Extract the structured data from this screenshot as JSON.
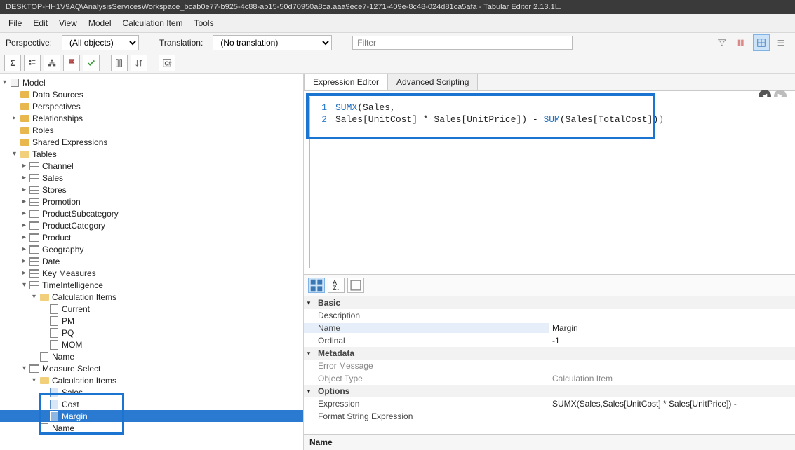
{
  "window": {
    "title": "DESKTOP-HH1V9AQ\\AnalysisServicesWorkspace_bcab0e77-b925-4c88-ab15-50d70950a8ca.aaa9ece7-1271-409e-8c48-024d81ca5afa - Tabular Editor 2.13.1",
    "btn_min": "—",
    "btn_max": "☐",
    "btn_close": "✕"
  },
  "menu": {
    "file": "File",
    "edit": "Edit",
    "view": "View",
    "model": "Model",
    "calcitem": "Calculation Item",
    "tools": "Tools"
  },
  "filters": {
    "perspective_lbl": "Perspective:",
    "perspective_val": "(All objects)",
    "translation_lbl": "Translation:",
    "translation_val": "(No translation)",
    "filter_ph": "Filter"
  },
  "tree": {
    "root": "Model",
    "datasources": "Data Sources",
    "perspectives": "Perspectives",
    "relationships": "Relationships",
    "roles": "Roles",
    "shared": "Shared Expressions",
    "tables": "Tables",
    "tbl": {
      "channel": "Channel",
      "sales": "Sales",
      "stores": "Stores",
      "promotion": "Promotion",
      "prodsub": "ProductSubcategory",
      "prodcat": "ProductCategory",
      "product": "Product",
      "geo": "Geography",
      "date": "Date",
      "keym": "Key Measures",
      "timeint": "TimeIntelligence",
      "meassel": "Measure Select"
    },
    "calcitems": "Calculation Items",
    "ti": {
      "current": "Current",
      "pm": "PM",
      "pq": "PQ",
      "mom": "MOM"
    },
    "name": "Name",
    "ms": {
      "sales": "Sales",
      "cost": "Cost",
      "margin": "Margin"
    }
  },
  "tabs": {
    "expr": "Expression Editor",
    "adv": "Advanced Scripting"
  },
  "code": {
    "l1a": "SUMX",
    "l1b": "(Sales,",
    "l2a": "Sales[UnitCost] * Sales[UnitPrice]) - ",
    "l2b": "SUM",
    "l2c": "(Sales[TotalCost])",
    "l2d": ")"
  },
  "props": {
    "cat_basic": "Basic",
    "cat_meta": "Metadata",
    "cat_opt": "Options",
    "desc_k": "Description",
    "desc_v": "",
    "name_k": "Name",
    "name_v": "Margin",
    "ord_k": "Ordinal",
    "ord_v": "-1",
    "err_k": "Error Message",
    "err_v": "",
    "objt_k": "Object Type",
    "objt_v": "Calculation Item",
    "expr_k": "Expression",
    "expr_v": "SUMX(Sales,Sales[UnitCost] * Sales[UnitPrice]) -",
    "fstr_k": "Format String Expression",
    "fstr_v": ""
  },
  "foot": {
    "title": "Name"
  }
}
